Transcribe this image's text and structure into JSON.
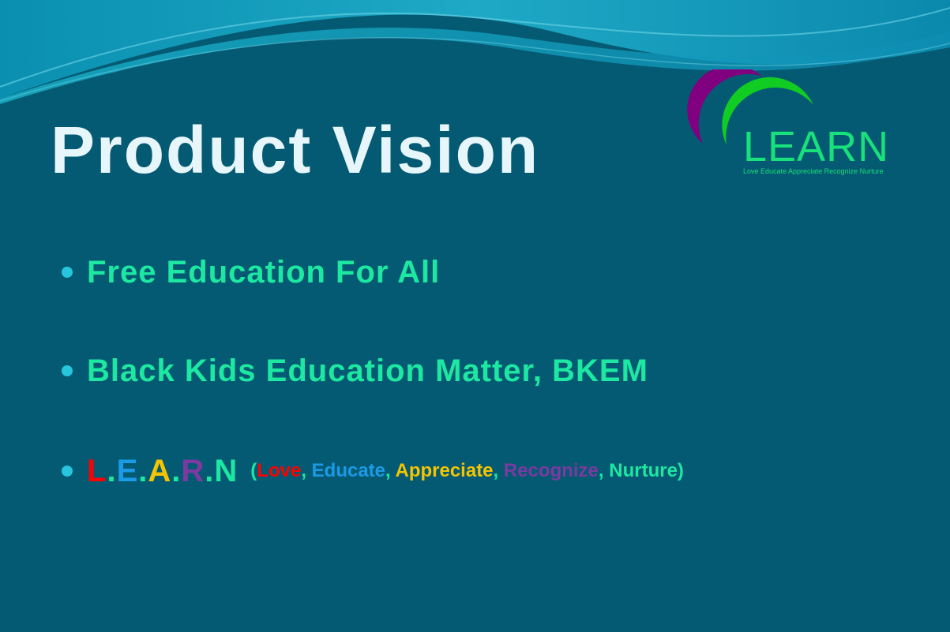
{
  "slide": {
    "title": "Product Vision"
  },
  "logo": {
    "word": "LEARN",
    "tagline": "Love Educate Appreciate Recognize Nurture",
    "arc_colors": [
      "#ffff33",
      "#800080",
      "#11cc22",
      "#0022cc",
      "#ff0000"
    ]
  },
  "bullets": [
    {
      "text": "Free Education For All"
    },
    {
      "text": "Black Kids Education Matter, BKEM"
    }
  ],
  "learn_bullet": {
    "letters": [
      {
        "char": "L",
        "color": "#ff0000"
      },
      {
        "char": ".",
        "color": "#1de8a2"
      },
      {
        "char": "E",
        "color": "#1b9ae6"
      },
      {
        "char": ".",
        "color": "#1de8a2"
      },
      {
        "char": "A",
        "color": "#f5c400"
      },
      {
        "char": ".",
        "color": "#1de8a2"
      },
      {
        "char": "R",
        "color": "#7a3aa0"
      },
      {
        "char": ".",
        "color": "#1de8a2"
      },
      {
        "char": "N",
        "color": "#1de8a2"
      }
    ],
    "description": [
      {
        "text": "(",
        "color": "#1de8a2"
      },
      {
        "text": "Love",
        "color": "#ff0000"
      },
      {
        "text": ", ",
        "color": "#1de8a2"
      },
      {
        "text": "Educate",
        "color": "#1b9ae6"
      },
      {
        "text": ", ",
        "color": "#1de8a2"
      },
      {
        "text": "Appreciate",
        "color": "#f5c400"
      },
      {
        "text": ", ",
        "color": "#1de8a2"
      },
      {
        "text": "Recognize",
        "color": "#7a3aa0"
      },
      {
        "text": ", Nurture)",
        "color": "#1de8a2"
      }
    ]
  },
  "colors": {
    "background": "#045a72",
    "title": "#e6f6fa",
    "bullet_text": "#1de8a2",
    "bullet_dot": "#27c6dc"
  }
}
